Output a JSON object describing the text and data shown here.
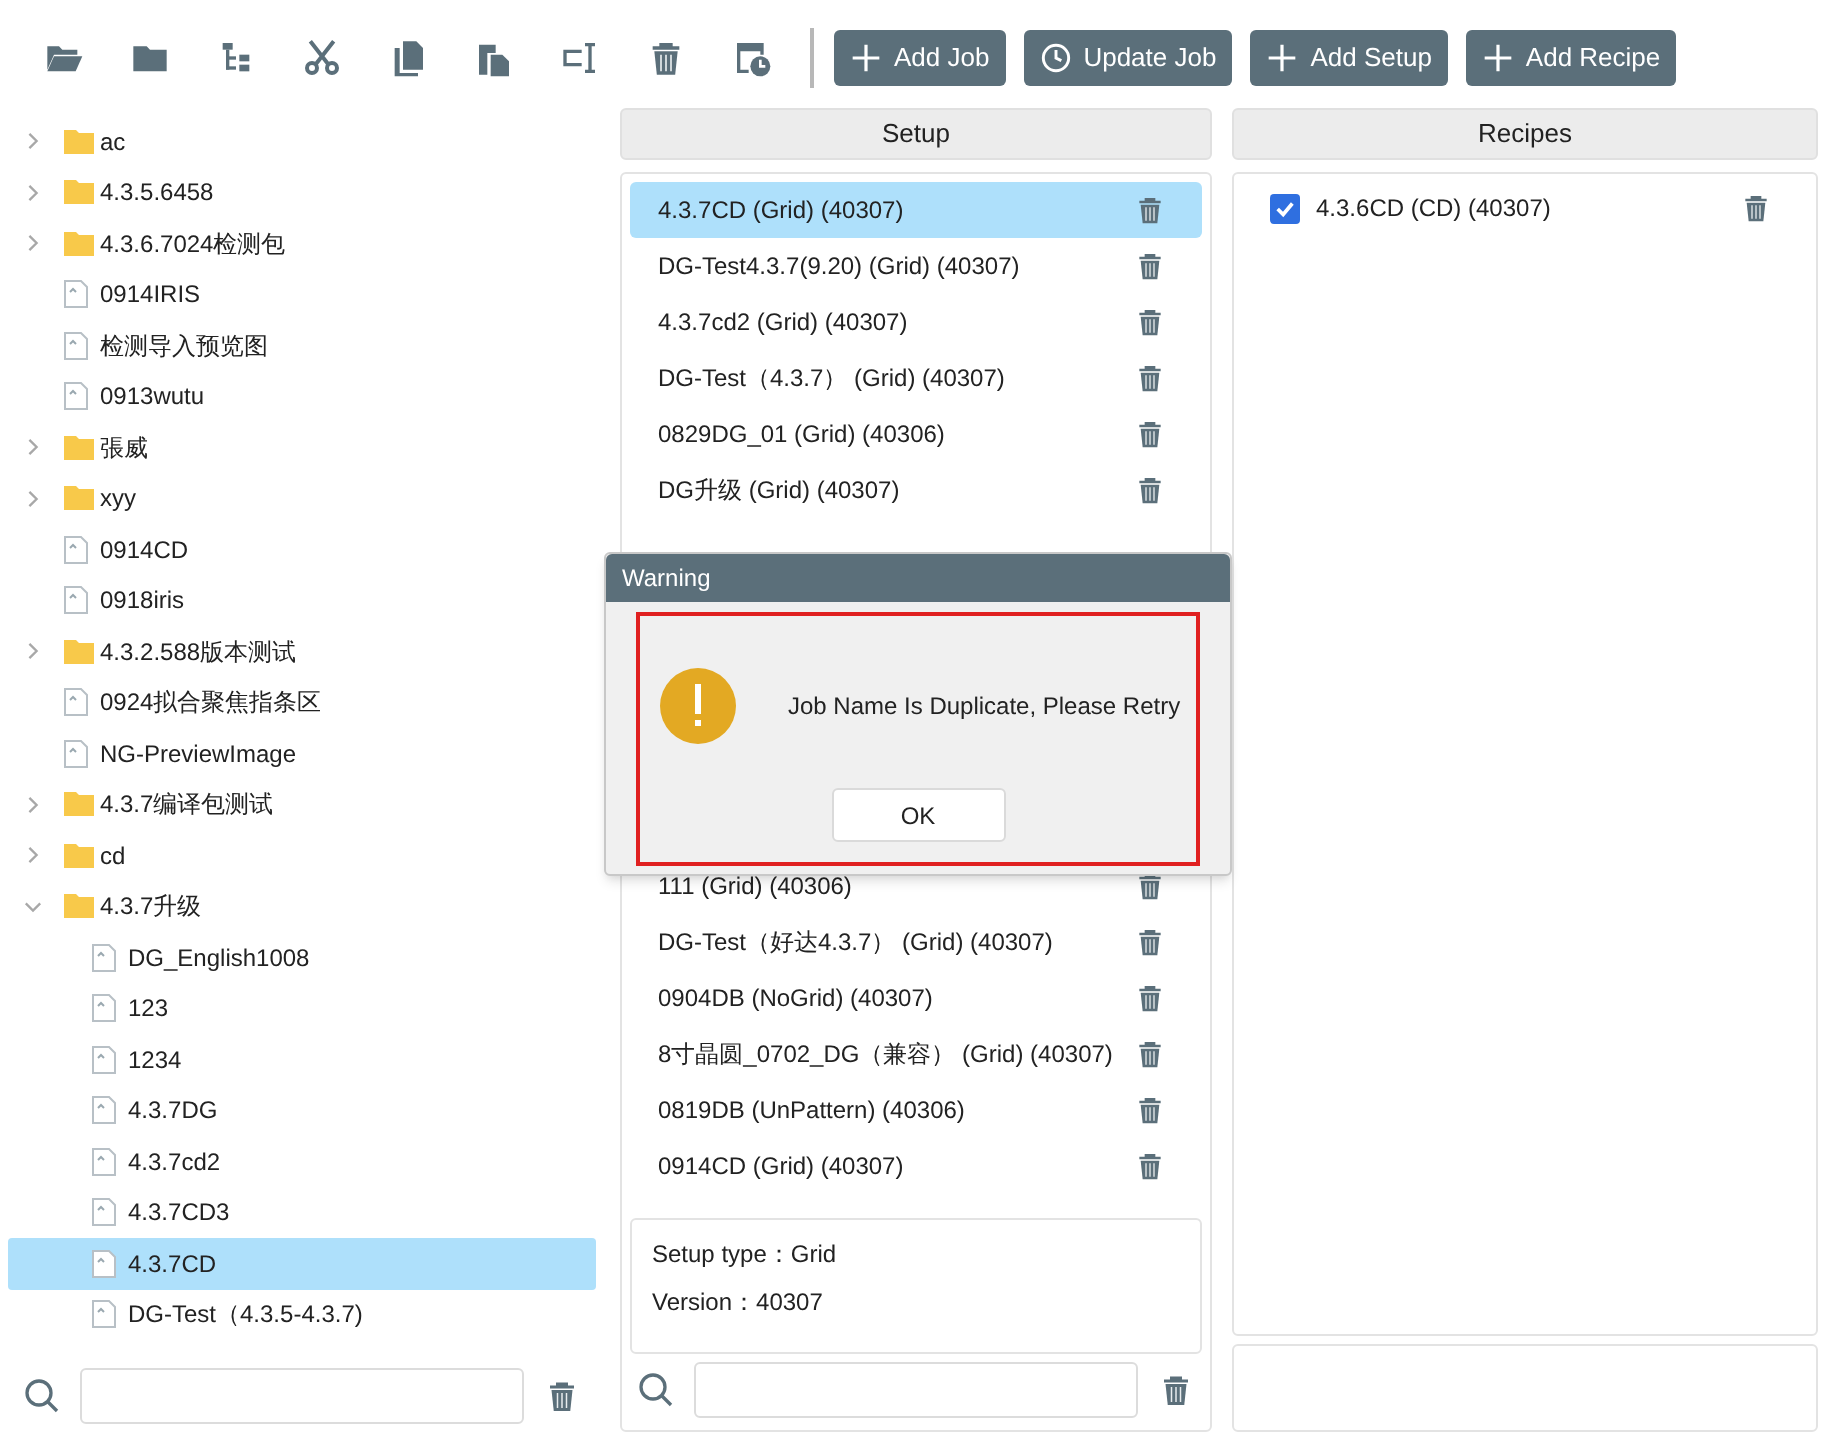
{
  "toolbar": {
    "icons": [
      {
        "kind": "open"
      },
      {
        "kind": "folder"
      },
      {
        "kind": "tree"
      },
      {
        "kind": "cut"
      },
      {
        "kind": "copy"
      },
      {
        "kind": "paste"
      },
      {
        "kind": "rename"
      },
      {
        "kind": "delete"
      },
      {
        "kind": "history"
      }
    ],
    "buttons": [
      {
        "label": "Add Job",
        "kind": "plus"
      },
      {
        "label": "Update Job",
        "kind": "clock"
      },
      {
        "label": "Add Setup",
        "kind": "plus"
      },
      {
        "label": "Add Recipe",
        "kind": "plus"
      }
    ]
  },
  "tree": {
    "items": [
      {
        "label": "ac",
        "kind": "folder",
        "expanded": false,
        "selected": false
      },
      {
        "label": "4.3.5.6458",
        "kind": "folder",
        "expanded": false,
        "selected": false
      },
      {
        "label": "4.3.6.7024检测包",
        "kind": "folder",
        "expanded": false,
        "selected": false
      },
      {
        "label": "0914IRIS",
        "kind": "file",
        "selected": false
      },
      {
        "label": "检测导入预览图",
        "kind": "file",
        "selected": false
      },
      {
        "label": "0913wutu",
        "kind": "file",
        "selected": false
      },
      {
        "label": "張威",
        "kind": "folder",
        "expanded": false,
        "selected": false
      },
      {
        "label": "xyy",
        "kind": "folder",
        "expanded": false,
        "selected": false
      },
      {
        "label": "0914CD",
        "kind": "file",
        "selected": false
      },
      {
        "label": "0918iris",
        "kind": "file",
        "selected": false
      },
      {
        "label": "4.3.2.588版本测试",
        "kind": "folder",
        "expanded": false,
        "selected": false
      },
      {
        "label": "0924拟合聚焦指条区",
        "kind": "file",
        "selected": false
      },
      {
        "label": "NG-PreviewImage",
        "kind": "file",
        "selected": false
      },
      {
        "label": "4.3.7编译包测试",
        "kind": "folder",
        "expanded": false,
        "selected": false
      },
      {
        "label": "cd",
        "kind": "folder",
        "expanded": false,
        "selected": false
      },
      {
        "label": "4.3.7升级",
        "kind": "folder",
        "expanded": true,
        "selected": false,
        "children": [
          {
            "label": "DG_English1008",
            "kind": "file",
            "selected": false
          },
          {
            "label": "123",
            "kind": "file",
            "selected": false
          },
          {
            "label": "1234",
            "kind": "file",
            "selected": false
          },
          {
            "label": "4.3.7DG",
            "kind": "file",
            "selected": false
          },
          {
            "label": "4.3.7cd2",
            "kind": "file",
            "selected": false
          },
          {
            "label": "4.3.7CD3",
            "kind": "file",
            "selected": false
          },
          {
            "label": "4.3.7CD",
            "kind": "file",
            "selected": true
          },
          {
            "label": "DG-Test（4.3.5-4.3.7)",
            "kind": "file",
            "selected": false
          }
        ]
      }
    ]
  },
  "setup": {
    "header": "Setup",
    "items": [
      {
        "label": "4.3.7CD (Grid) (40307)",
        "selected": true
      },
      {
        "label": "DG-Test4.3.7(9.20) (Grid) (40307)",
        "selected": false
      },
      {
        "label": "4.3.7cd2 (Grid) (40307)",
        "selected": false
      },
      {
        "label": "DG-Test（4.3.7） (Grid) (40307)",
        "selected": false
      },
      {
        "label": "0829DG_01 (Grid) (40306)",
        "selected": false
      },
      {
        "label": "DG升级 (Grid) (40307)",
        "selected": false
      },
      {
        "label": "111 (Grid) (40306)",
        "selected": false
      },
      {
        "label": "DG-Test（好达4.3.7） (Grid) (40307)",
        "selected": false
      },
      {
        "label": "0904DB (NoGrid) (40307)",
        "selected": false
      },
      {
        "label": "8寸晶圆_0702_DG（兼容） (Grid) (40307)",
        "selected": false
      },
      {
        "label": "0819DB (UnPattern) (40306)",
        "selected": false
      },
      {
        "label": "0914CD (Grid) (40307)",
        "selected": false
      }
    ],
    "info": [
      "Setup type：Grid",
      "Version：40307"
    ]
  },
  "recipes": {
    "header": "Recipes",
    "items": [
      {
        "label": "4.3.6CD (CD) (40307)",
        "checked": true
      }
    ]
  },
  "dialog": {
    "title": "Warning",
    "message": "Job Name Is Duplicate, Please Retry",
    "button": "OK"
  }
}
